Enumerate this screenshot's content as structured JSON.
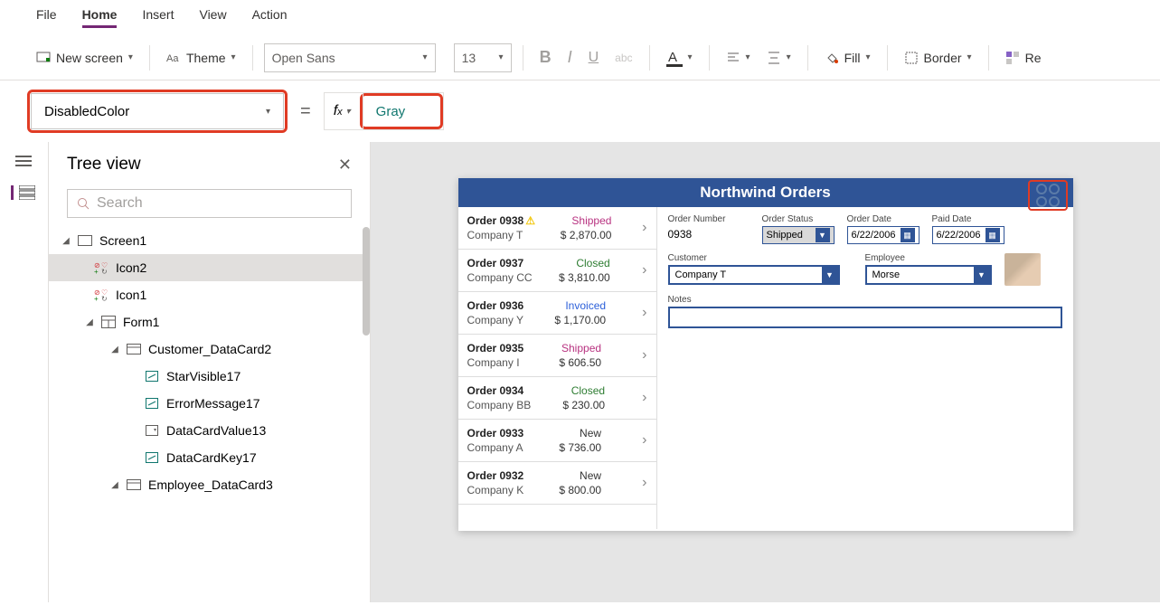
{
  "menu": {
    "file": "File",
    "home": "Home",
    "insert": "Insert",
    "view": "View",
    "action": "Action"
  },
  "ribbon": {
    "new_screen": "New screen",
    "theme": "Theme",
    "font": "Open Sans",
    "size": "13",
    "fill": "Fill",
    "border": "Border",
    "reorder": "Re"
  },
  "formula": {
    "property": "DisabledColor",
    "value": "Gray"
  },
  "tree": {
    "title": "Tree view",
    "search_placeholder": "Search",
    "nodes": {
      "screen1": "Screen1",
      "icon2": "Icon2",
      "icon1": "Icon1",
      "form1": "Form1",
      "customer_card": "Customer_DataCard2",
      "star": "StarVisible17",
      "error": "ErrorMessage17",
      "value": "DataCardValue13",
      "key": "DataCardKey17",
      "employee_card": "Employee_DataCard3"
    }
  },
  "app": {
    "title": "Northwind Orders",
    "orders": [
      {
        "id": "Order 0938",
        "company": "Company T",
        "status": "Shipped",
        "amount": "$ 2,870.00",
        "warn": true
      },
      {
        "id": "Order 0937",
        "company": "Company CC",
        "status": "Closed",
        "amount": "$ 3,810.00"
      },
      {
        "id": "Order 0936",
        "company": "Company Y",
        "status": "Invoiced",
        "amount": "$ 1,170.00"
      },
      {
        "id": "Order 0935",
        "company": "Company I",
        "status": "Shipped",
        "amount": "$ 606.50"
      },
      {
        "id": "Order 0934",
        "company": "Company BB",
        "status": "Closed",
        "amount": "$ 230.00"
      },
      {
        "id": "Order 0933",
        "company": "Company A",
        "status": "New",
        "amount": "$ 736.00"
      },
      {
        "id": "Order 0932",
        "company": "Company K",
        "status": "New",
        "amount": "$ 800.00"
      }
    ],
    "detail": {
      "order_number_label": "Order Number",
      "order_number": "0938",
      "order_status_label": "Order Status",
      "order_status": "Shipped",
      "order_date_label": "Order Date",
      "order_date": "6/22/2006",
      "paid_date_label": "Paid Date",
      "paid_date": "6/22/2006",
      "customer_label": "Customer",
      "customer": "Company T",
      "employee_label": "Employee",
      "employee": "Morse",
      "notes_label": "Notes"
    }
  }
}
